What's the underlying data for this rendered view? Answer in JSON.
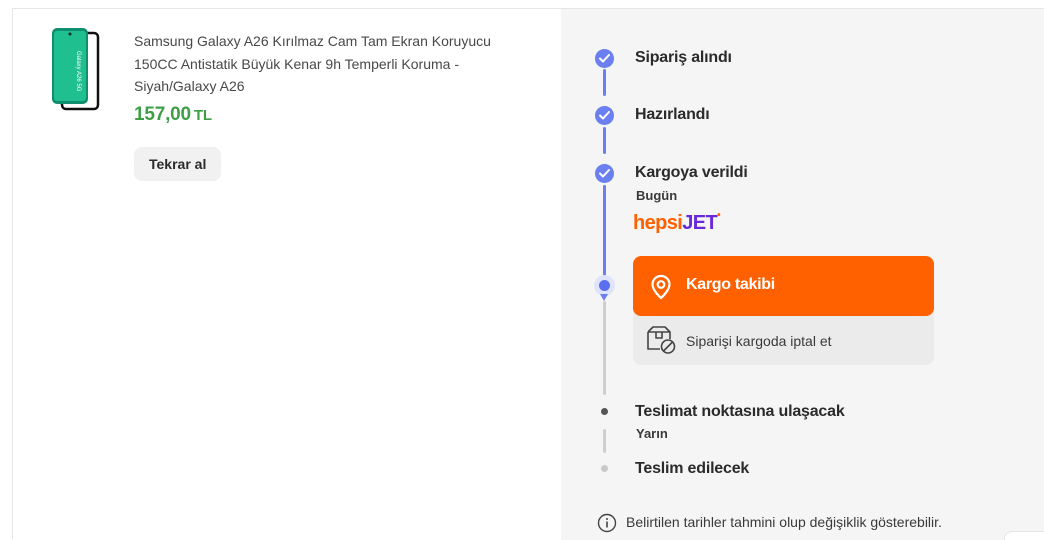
{
  "product": {
    "title": "Samsung Galaxy A26 Kırılmaz Cam Tam Ekran Koruyucu 150CC Antistatik Büyük Kenar 9h Temperli Koruma - Siyah/Galaxy A26",
    "price_value": "157,00",
    "price_currency": "TL",
    "thumb_text": "Galaxy A26 5G",
    "reorder_label": "Tekrar al"
  },
  "timeline": {
    "steps": [
      {
        "label": "Sipariş alındı",
        "status": "done"
      },
      {
        "label": "Hazırlandı",
        "status": "done"
      },
      {
        "label": "Kargoya verildi",
        "sub": "Bugün",
        "status": "done"
      },
      {
        "label": "Teslimat noktasına ulaşacak",
        "sub": "Yarın",
        "status": "pending"
      },
      {
        "label": "Teslim edilecek",
        "status": "pending"
      }
    ],
    "carrier": {
      "part1": "hepsi",
      "part2": "JET",
      "mark": "•"
    },
    "track_button_label": "Kargo takibi",
    "cancel_label": "Siparişi kargoda iptal et",
    "footnote": "Belirtilen tarihler tahmini olup değişiklik gösterebilir."
  },
  "colors": {
    "accent_orange": "#ff6000",
    "price_green": "#3e9f47",
    "timeline_blue": "#6b7ff0",
    "panel_bg": "#f5f5f5"
  },
  "icons": {
    "check": "check-icon",
    "pin": "location-pin-icon",
    "cancel": "package-cancel-icon",
    "info": "info-icon"
  }
}
